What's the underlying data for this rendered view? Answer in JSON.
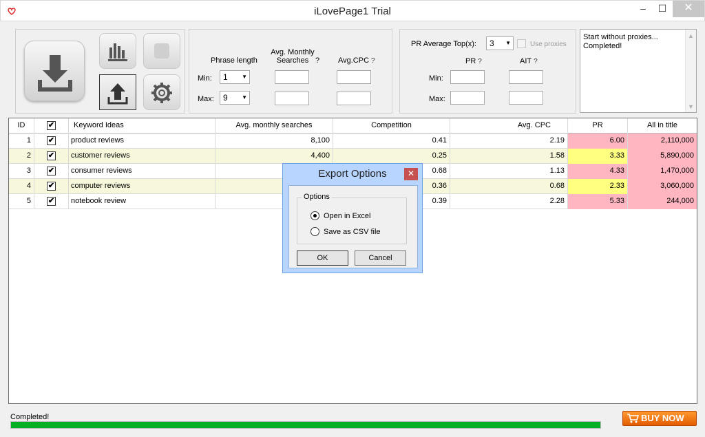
{
  "window": {
    "title": "iLovePage1 Trial",
    "minimize": "–",
    "maximize": "☐",
    "close": "✕"
  },
  "filters": {
    "phrase_length_label": "Phrase length",
    "avg_monthly_label_1": "Avg. Monthly",
    "avg_monthly_label_2": "Searches",
    "avg_cpc_label": "Avg.CPC",
    "help": "?",
    "min_label": "Min:",
    "max_label": "Max:",
    "phrase_min": "1",
    "phrase_max": "9",
    "dropdown_arrow": "▼"
  },
  "pr_filters": {
    "pr_avg_label": "PR Average Top(x):",
    "pr_avg_value": "3",
    "use_proxies_label": "Use proxies",
    "pr_label": "PR",
    "ait_label": "AIT",
    "min_label": "Min:",
    "max_label": "Max:"
  },
  "log": {
    "lines": [
      "Start without proxies...",
      "Completed!"
    ],
    "scroll_up": "▲",
    "scroll_down": "▼"
  },
  "table": {
    "headers": {
      "id": "ID",
      "check": "✔",
      "keyword": "Keyword Ideas",
      "ams": "Avg. monthly searches",
      "comp": "Competition",
      "cpc": "Avg. CPC",
      "pr": "PR",
      "ait": "All in title"
    },
    "rows": [
      {
        "id": "1",
        "keyword": "product reviews",
        "ams": "8,100",
        "comp": "0.41",
        "cpc": "2.19",
        "pr": "6.00",
        "ait": "2,110,000"
      },
      {
        "id": "2",
        "keyword": "customer reviews",
        "ams": "4,400",
        "comp": "0.25",
        "cpc": "1.58",
        "pr": "3.33",
        "ait": "5,890,000"
      },
      {
        "id": "3",
        "keyword": "consumer reviews",
        "ams": "",
        "comp": "0.68",
        "cpc": "1.13",
        "pr": "4.33",
        "ait": "1,470,000"
      },
      {
        "id": "4",
        "keyword": "computer reviews",
        "ams": "",
        "comp": "0.36",
        "cpc": "0.68",
        "pr": "2.33",
        "ait": "3,060,000"
      },
      {
        "id": "5",
        "keyword": "notebook review",
        "ams": "",
        "comp": "0.39",
        "cpc": "2.28",
        "pr": "5.33",
        "ait": "244,000"
      }
    ],
    "check_mark": "✔"
  },
  "colors": {
    "row_alt": "#f7f7dc",
    "pr_pink": "#ffb6c1",
    "pr_yellow": "#ffff80",
    "ait_pink": "#ffb6c1",
    "progress_green": "#06b025",
    "buy_orange": "#ff7a00"
  },
  "status": {
    "text": "Completed!",
    "progress": 1.0
  },
  "buy_now": "BUY NOW",
  "dialog": {
    "title": "Export Options",
    "close": "✕",
    "group_label": "Options",
    "option_excel": "Open in Excel",
    "option_csv": "Save as CSV file",
    "ok": "OK",
    "cancel": "Cancel"
  }
}
